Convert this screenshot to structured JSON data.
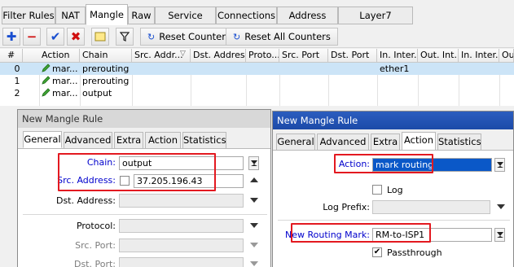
{
  "tabs": [
    "Filter Rules",
    "NAT",
    "Mangle",
    "Raw",
    "Service Ports",
    "Connections",
    "Address Lists",
    "Layer7 Protocols"
  ],
  "toolbar": {
    "reset_counters": "Reset Counters",
    "reset_all_counters": "Reset All Counters"
  },
  "table": {
    "columns": [
      "#",
      "Action",
      "Chain",
      "Src. Addr...",
      "Dst. Address",
      "Proto...",
      "Src. Port",
      "Dst. Port",
      "In. Inter...",
      "Out. Int...",
      "In. Inter...",
      "Out"
    ],
    "rows": [
      {
        "num": "0",
        "action": "mar...",
        "chain": "prerouting",
        "in_inter": "ether1"
      },
      {
        "num": "1",
        "action": "mar...",
        "chain": "prerouting",
        "in_inter": ""
      },
      {
        "num": "2",
        "action": "mar...",
        "chain": "output",
        "in_inter": ""
      }
    ]
  },
  "dialog1": {
    "title": "New Mangle Rule",
    "tabs": [
      "General",
      "Advanced",
      "Extra",
      "Action",
      "Statistics"
    ],
    "chain_label": "Chain:",
    "chain_value": "output",
    "src_address_label": "Src. Address:",
    "src_address_value": "37.205.196.43",
    "dst_address_label": "Dst. Address:",
    "protocol_label": "Protocol:",
    "src_port_label": "Src. Port:",
    "dst_port_label": "Dst. Port:"
  },
  "dialog2": {
    "title": "New Mangle Rule",
    "tabs": [
      "General",
      "Advanced",
      "Extra",
      "Action",
      "Statistics"
    ],
    "action_label": "Action:",
    "action_value": "mark routing",
    "log_label": "Log",
    "log_prefix_label": "Log Prefix:",
    "routing_mark_label": "New Routing Mark:",
    "routing_mark_value": "RM-to-ISP1",
    "passthrough_label": "Passthrough"
  },
  "colors": {
    "highlight_box": "#e31920",
    "selected_row": "#cce4f7",
    "label_blue": "#0000cc",
    "title_active": "#1c4aa8"
  }
}
